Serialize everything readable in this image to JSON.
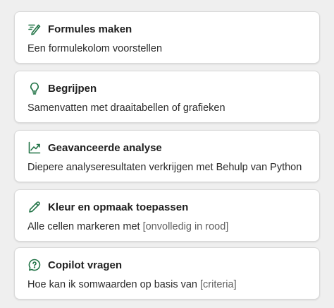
{
  "accent_color": "#217346",
  "cards": [
    {
      "icon": "formula-pen-icon",
      "title": "Formules maken",
      "description": "Een formulekolom voorstellen",
      "placeholder": ""
    },
    {
      "icon": "lightbulb-icon",
      "title": "Begrijpen",
      "description": "Samenvatten met draaitabellen of grafieken",
      "placeholder": ""
    },
    {
      "icon": "trend-chart-icon",
      "title": "Geavanceerde analyse",
      "description": "Diepere analyseresultaten verkrijgen met Behulp van Python",
      "placeholder": ""
    },
    {
      "icon": "pencil-icon",
      "title": "Kleur en opmaak toepassen",
      "description": "Alle cellen markeren met ",
      "placeholder": "[onvolledig in rood]"
    },
    {
      "icon": "chat-question-icon",
      "title": "Copilot vragen",
      "description": "Hoe kan ik somwaarden op basis van ",
      "placeholder": "[criteria]"
    }
  ]
}
